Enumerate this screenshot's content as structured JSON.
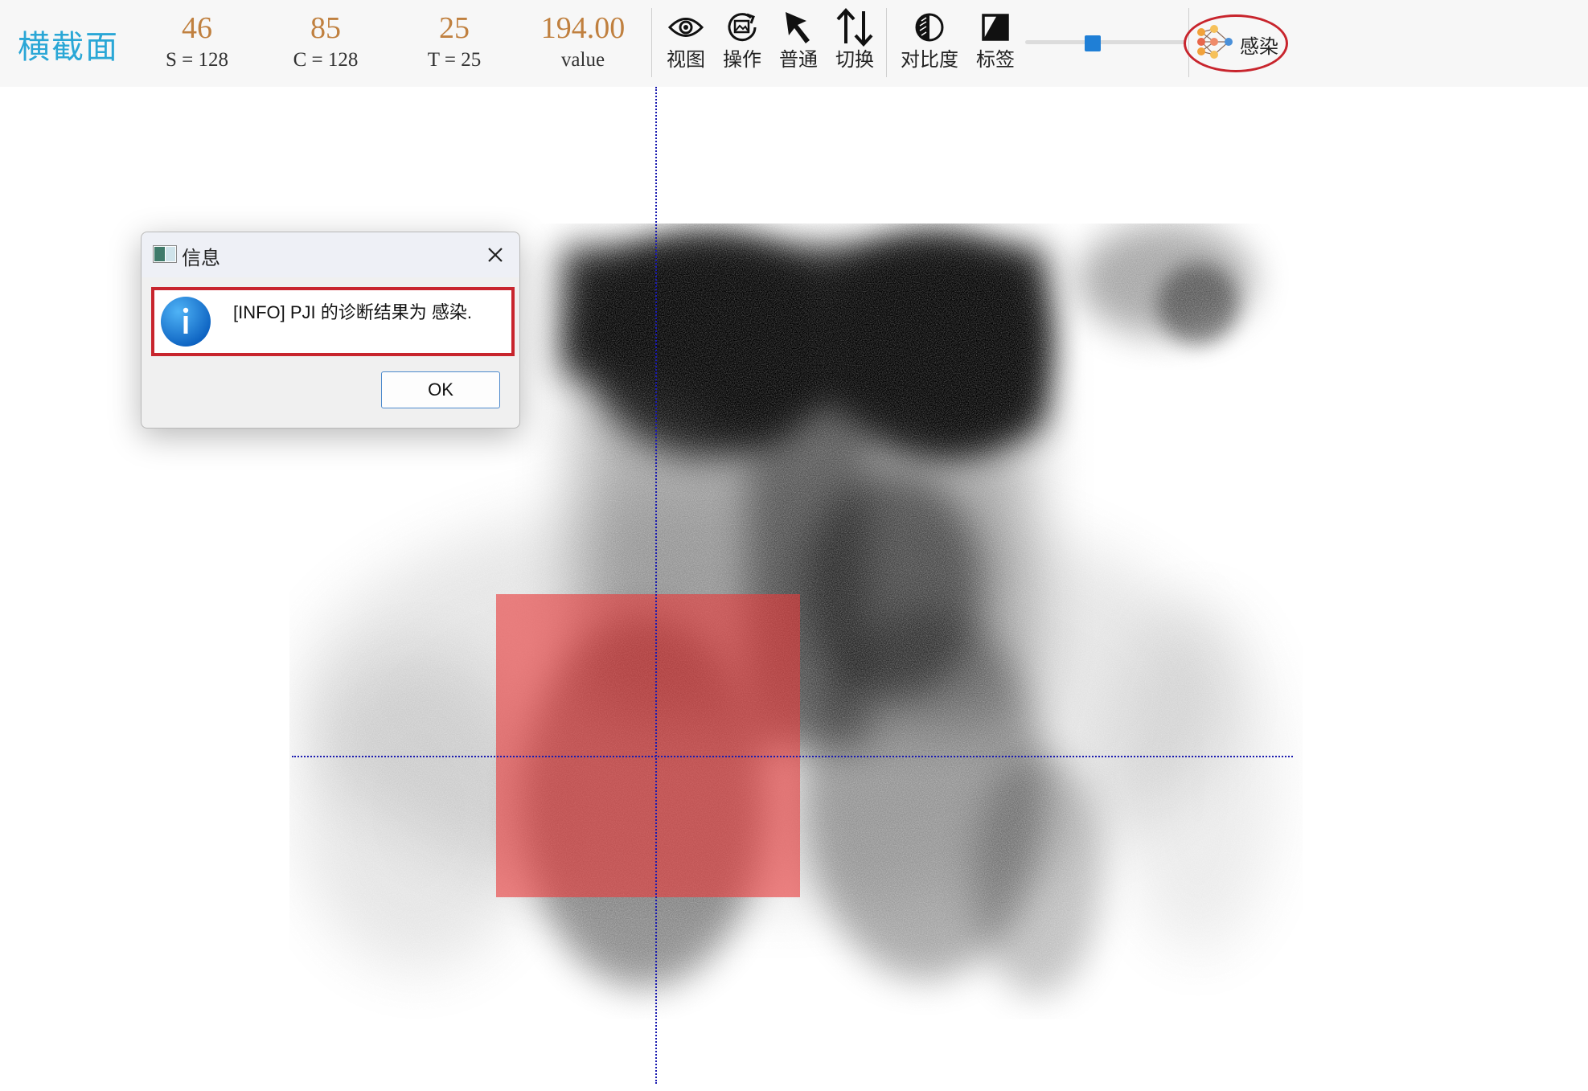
{
  "toolbar": {
    "title": "横截面",
    "stats": [
      {
        "value": "46",
        "label": "S = 128"
      },
      {
        "value": "85",
        "label": "C = 128"
      },
      {
        "value": "25",
        "label": "T = 25"
      },
      {
        "value": "194.00",
        "label": "value"
      }
    ],
    "buttons": [
      {
        "label": "视图",
        "icon": "eye-icon"
      },
      {
        "label": "操作",
        "icon": "refresh-image-icon"
      },
      {
        "label": "普通",
        "icon": "cursor-arrow-icon"
      },
      {
        "label": "切换",
        "icon": "swap-arrows-icon"
      },
      {
        "label": "对比度",
        "icon": "contrast-icon"
      },
      {
        "label": "标签",
        "icon": "label-icon"
      }
    ],
    "slider": {
      "level": 0.41
    },
    "infection_button": {
      "label": "感染",
      "icon": "neural-network-icon",
      "highlight_color": "#c8252d"
    }
  },
  "viewer": {
    "overlay_color": "#e83c3c",
    "crosshair_color": "#1b1bb0"
  },
  "dialog": {
    "title": "信息",
    "message": "[INFO] PJI 的诊断结果为 感染.",
    "ok_label": "OK",
    "icon": "info-icon"
  },
  "colors": {
    "accent_title": "#2aa7d6",
    "stat_value": "#c0803f",
    "highlight": "#c8252d",
    "slider_thumb": "#1f7fd6"
  }
}
